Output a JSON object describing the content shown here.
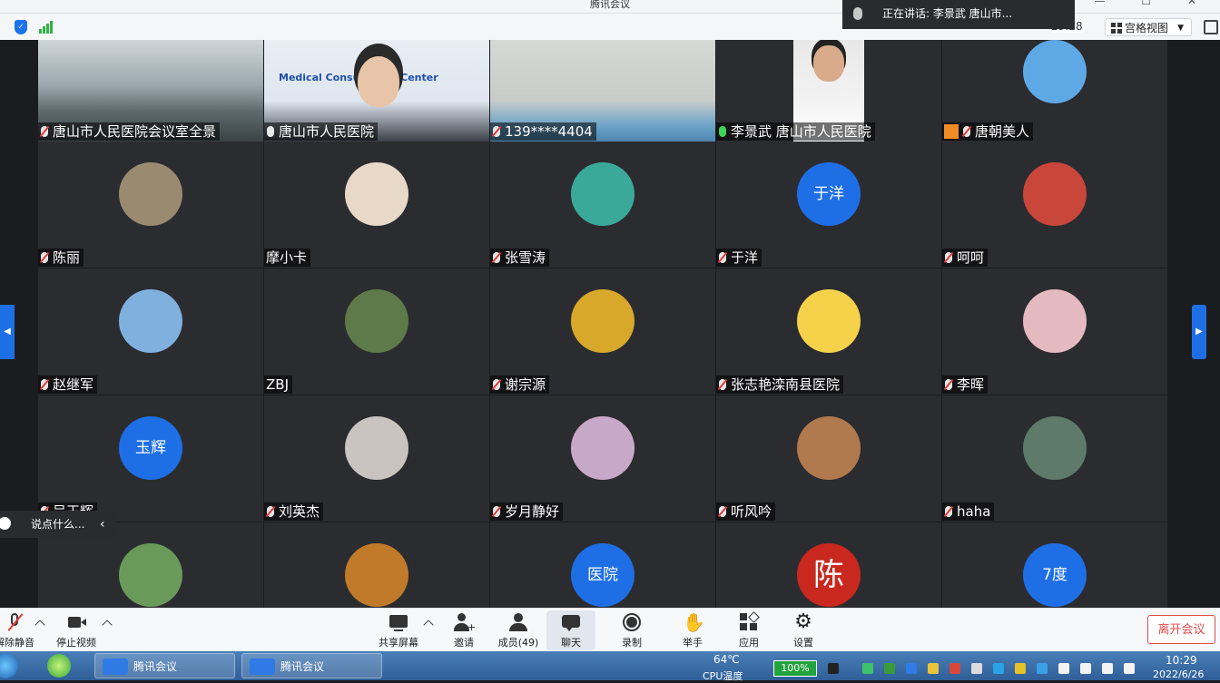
{
  "window": {
    "title": "腾讯会议"
  },
  "topbar": {
    "timer": "29:28",
    "view_label": "宫格视图",
    "speaking_label": "正在讲话: 李景武 唐山市..."
  },
  "participants": [
    {
      "name": "唐山市人民医院会议室全景",
      "mic": "muted",
      "kind": "video",
      "scene": "room"
    },
    {
      "name": "唐山市人民医院",
      "mic": "on",
      "kind": "video",
      "scene": "person",
      "sign": "Medical Consultation Center"
    },
    {
      "name": "139****4404",
      "mic": "muted",
      "kind": "video",
      "scene": "ceiling"
    },
    {
      "name": "李景武 唐山市人民医院",
      "mic": "active",
      "kind": "video",
      "scene": "doctor",
      "speaking": true
    },
    {
      "name": "唐朝美人",
      "mic": "muted",
      "kind": "avatar",
      "avatar_color": "#5fa8e6",
      "avatar_text": ""
    },
    {
      "name": "陈丽",
      "mic": "muted",
      "kind": "avatar",
      "avatar_color": "#9a8a70"
    },
    {
      "name": "摩小卡",
      "mic": "none",
      "kind": "avatar",
      "avatar_color": "#e8d8c8"
    },
    {
      "name": "张雪涛",
      "mic": "muted",
      "kind": "avatar",
      "avatar_color": "#3aa99a"
    },
    {
      "name": "于洋",
      "mic": "muted",
      "kind": "avatar",
      "avatar_color": "#1e6fe6",
      "avatar_text": "于洋"
    },
    {
      "name": "呵呵",
      "mic": "muted",
      "kind": "avatar",
      "avatar_color": "#c9463a"
    },
    {
      "name": "赵继军",
      "mic": "muted",
      "kind": "avatar",
      "avatar_color": "#7fb0de"
    },
    {
      "name": "ZBJ",
      "mic": "none",
      "kind": "avatar",
      "avatar_color": "#5f7a4a"
    },
    {
      "name": "谢宗源",
      "mic": "muted",
      "kind": "avatar",
      "avatar_color": "#d7a82a"
    },
    {
      "name": "张志艳滦南县医院",
      "mic": "muted",
      "kind": "avatar",
      "avatar_color": "#f5d24a"
    },
    {
      "name": "李晖",
      "mic": "muted",
      "kind": "avatar",
      "avatar_color": "#e5b9c0"
    },
    {
      "name": "吴玉辉",
      "mic": "muted",
      "kind": "avatar",
      "avatar_color": "#1e6fe6",
      "avatar_text": "玉辉"
    },
    {
      "name": "刘英杰",
      "mic": "muted",
      "kind": "avatar",
      "avatar_color": "#c9c4c0"
    },
    {
      "name": "岁月静好",
      "mic": "muted",
      "kind": "avatar",
      "avatar_color": "#c8a8c8"
    },
    {
      "name": "听风吟",
      "mic": "muted",
      "kind": "avatar",
      "avatar_color": "#b07a4e"
    },
    {
      "name": "haha",
      "mic": "muted",
      "kind": "avatar",
      "avatar_color": "#5e7a6a"
    },
    {
      "name": "",
      "mic": "none",
      "kind": "avatar",
      "avatar_color": "#6a9a5a"
    },
    {
      "name": "",
      "mic": "none",
      "kind": "avatar",
      "avatar_color": "#c07a2a"
    },
    {
      "name": "",
      "mic": "none",
      "kind": "avatar",
      "avatar_color": "#1e6fe6",
      "avatar_text": "医院"
    },
    {
      "name": "",
      "mic": "none",
      "kind": "avatar",
      "avatar_color": "#c8281e",
      "avatar_text": "陈"
    },
    {
      "name": "",
      "mic": "none",
      "kind": "avatar",
      "avatar_color": "#1e6fe6",
      "avatar_text": "7度"
    }
  ],
  "chat": {
    "placeholder": "说点什么..."
  },
  "toolbar": {
    "unmute": "解除静音",
    "stop_video": "停止视频",
    "share": "共享屏幕",
    "invite": "邀请",
    "members": "成员(49)",
    "chat": "聊天",
    "record": "录制",
    "raise_hand": "举手",
    "apps": "应用",
    "settings": "设置",
    "leave": "离开会议"
  },
  "taskbar": {
    "tasks": [
      "腾讯会议",
      "腾讯会议"
    ],
    "temp": "64℃",
    "cpu": "CPU温度",
    "battery": "100%",
    "time": "10:29",
    "date": "2022/6/26"
  }
}
